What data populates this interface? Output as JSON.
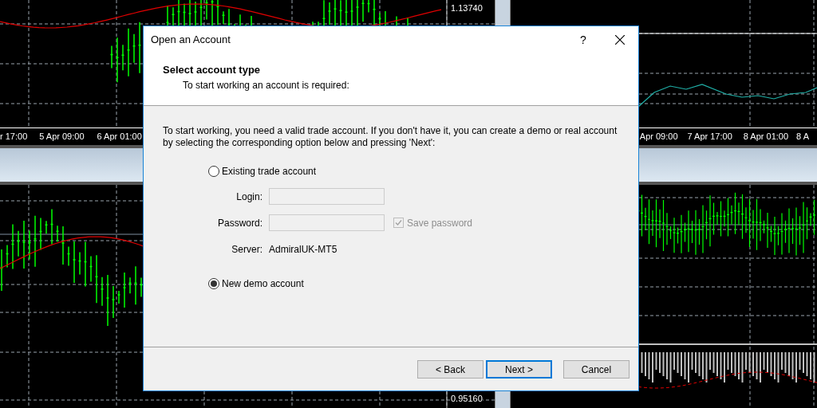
{
  "charts": {
    "price_labels": [
      {
        "text": "1.13740"
      },
      {
        "text": "0.95160"
      }
    ],
    "left_time_labels": [
      "r 17:00",
      "5 Apr 09:00",
      "6 Apr 01:00"
    ],
    "right_time_labels": [
      "Apr 09:00",
      "7 Apr 17:00",
      "8 Apr 01:00",
      "8 A"
    ]
  },
  "dialog": {
    "title": "Open an Account",
    "help": "?",
    "header": {
      "title": "Select account type",
      "subtitle": "To start working an account is required:"
    },
    "intro": "To start working, you need a valid trade account. If you don't have it, you can create a demo or real account by selecting the corresponding option below and pressing 'Next':",
    "existing": {
      "label": "Existing trade account",
      "selected": false
    },
    "fields": [
      {
        "kind": "input",
        "label": "Login:",
        "disabled": true
      },
      {
        "kind": "input",
        "label": "Password:",
        "disabled": true
      },
      {
        "kind": "text",
        "label": "Server:",
        "value": "AdmiralUK-MT5"
      }
    ],
    "save_password": {
      "label": "Save password",
      "checked": true,
      "disabled": true
    },
    "demo": {
      "label": "New demo account",
      "selected": true
    },
    "buttons": [
      {
        "label": "< Back",
        "focused": false
      },
      {
        "label": "Next >",
        "focused": true
      },
      {
        "label": "Cancel",
        "focused": false
      }
    ]
  }
}
